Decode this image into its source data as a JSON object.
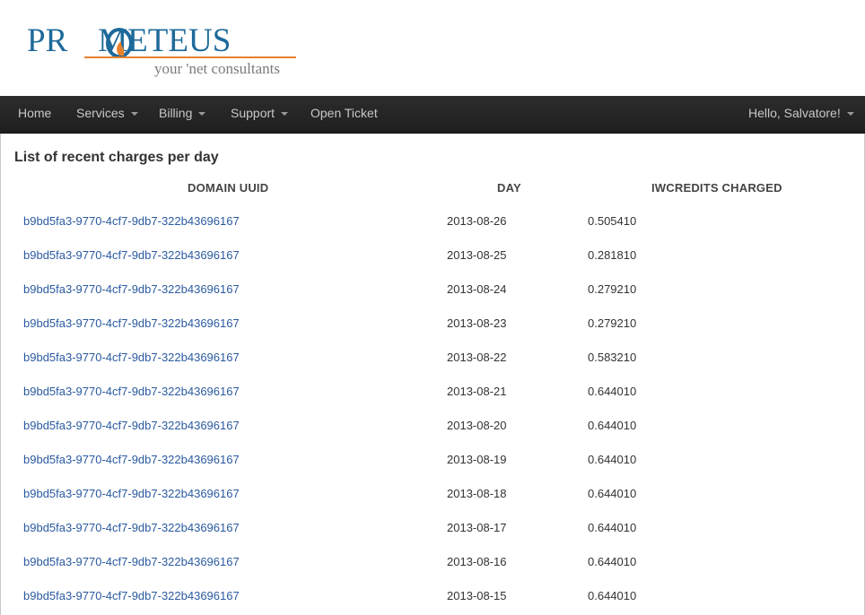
{
  "logo": {
    "word_left": "PR",
    "word_right": "METEUS",
    "tagline": "your 'net consultants",
    "colors": {
      "primary": "#1e6a9a",
      "accent": "#e8822a"
    }
  },
  "nav": {
    "items": [
      {
        "label": "Home",
        "dropdown": false
      },
      {
        "label": "Services",
        "dropdown": true
      },
      {
        "label": "Billing",
        "dropdown": true
      },
      {
        "label": "Support",
        "dropdown": true
      },
      {
        "label": "Open Ticket",
        "dropdown": false
      }
    ],
    "user_greeting": "Hello, Salvatore!",
    "user_dropdown": true
  },
  "main": {
    "title": "List of recent charges per day",
    "table": {
      "columns": [
        "Domain UUID",
        "Day",
        "IWCredits Charged"
      ],
      "rows": [
        {
          "uuid": "b9bd5fa3-9770-4cf7-9db7-322b43696167",
          "day": "2013-08-26",
          "credits": "0.505410"
        },
        {
          "uuid": "b9bd5fa3-9770-4cf7-9db7-322b43696167",
          "day": "2013-08-25",
          "credits": "0.281810"
        },
        {
          "uuid": "b9bd5fa3-9770-4cf7-9db7-322b43696167",
          "day": "2013-08-24",
          "credits": "0.279210"
        },
        {
          "uuid": "b9bd5fa3-9770-4cf7-9db7-322b43696167",
          "day": "2013-08-23",
          "credits": "0.279210"
        },
        {
          "uuid": "b9bd5fa3-9770-4cf7-9db7-322b43696167",
          "day": "2013-08-22",
          "credits": "0.583210"
        },
        {
          "uuid": "b9bd5fa3-9770-4cf7-9db7-322b43696167",
          "day": "2013-08-21",
          "credits": "0.644010"
        },
        {
          "uuid": "b9bd5fa3-9770-4cf7-9db7-322b43696167",
          "day": "2013-08-20",
          "credits": "0.644010"
        },
        {
          "uuid": "b9bd5fa3-9770-4cf7-9db7-322b43696167",
          "day": "2013-08-19",
          "credits": "0.644010"
        },
        {
          "uuid": "b9bd5fa3-9770-4cf7-9db7-322b43696167",
          "day": "2013-08-18",
          "credits": "0.644010"
        },
        {
          "uuid": "b9bd5fa3-9770-4cf7-9db7-322b43696167",
          "day": "2013-08-17",
          "credits": "0.644010"
        },
        {
          "uuid": "b9bd5fa3-9770-4cf7-9db7-322b43696167",
          "day": "2013-08-16",
          "credits": "0.644010"
        },
        {
          "uuid": "b9bd5fa3-9770-4cf7-9db7-322b43696167",
          "day": "2013-08-15",
          "credits": "0.644010"
        }
      ]
    }
  }
}
